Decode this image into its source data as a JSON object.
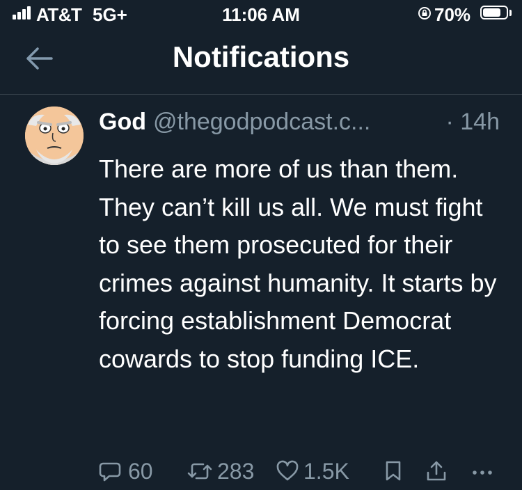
{
  "status_bar": {
    "carrier": "AT&T",
    "network": "5G+",
    "time": "11:06 AM",
    "battery_percent": "70%",
    "battery_level": 0.7,
    "icons": [
      "signal-icon",
      "orientation-lock-icon",
      "battery-icon"
    ]
  },
  "header": {
    "title": "Notifications",
    "back_icon": "arrow-left-icon"
  },
  "tweet": {
    "author_name": "God",
    "author_handle": "@thegodpodcast.c...",
    "time": "· 14h",
    "text": "There are more of us than them. They can’t kill us all. We must fight to see them prosecuted for their crimes against humanity. It starts by forcing establishment Democrat cowards to stop funding ICE.",
    "actions": {
      "replies": "60",
      "retweets": "283",
      "likes": "1.5K",
      "icons": [
        "reply-icon",
        "retweet-icon",
        "like-icon",
        "bookmark-icon",
        "share-icon",
        "more-icon"
      ]
    }
  },
  "colors": {
    "background": "#15202b",
    "text": "#ffffff",
    "secondary_text": "#8899a6",
    "divider": "#38444d"
  }
}
